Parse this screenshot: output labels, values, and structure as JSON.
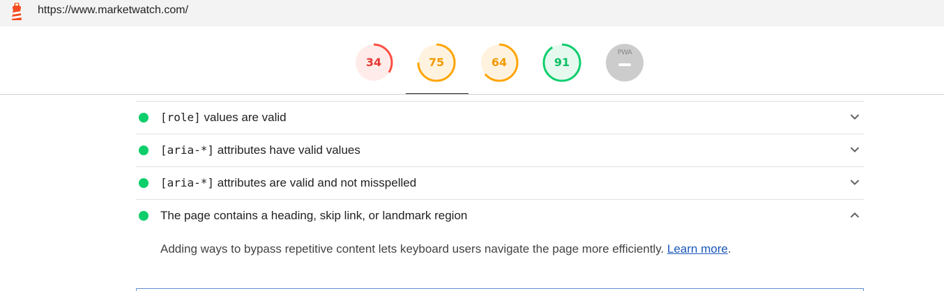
{
  "header": {
    "url": "https://www.marketwatch.com/",
    "logo_icon": "lighthouse-icon"
  },
  "scores": [
    {
      "label": "34",
      "value": 34,
      "color": "#ff4e42",
      "bg": "#ffecea"
    },
    {
      "label": "75",
      "value": 75,
      "color": "#ffa400",
      "bg": "#fff3e0"
    },
    {
      "label": "64",
      "value": 64,
      "color": "#ffa400",
      "bg": "#fff3e0"
    },
    {
      "label": "91",
      "value": 91,
      "color": "#0cce6b",
      "bg": "#e6f9ef"
    }
  ],
  "pwa": {
    "label": "PWA",
    "icon": "pwa-badge-icon",
    "color": "#cccccc"
  },
  "audits": [
    {
      "code": "[role]",
      "text": " values are valid",
      "expanded": false
    },
    {
      "code": "[aria-*]",
      "text": " attributes have valid values",
      "expanded": false
    },
    {
      "code": "[aria-*]",
      "text": " attributes are valid and not misspelled",
      "expanded": false
    },
    {
      "code": "",
      "text": "The page contains a heading, skip link, or landmark region",
      "expanded": true
    }
  ],
  "expanded": {
    "description": "Adding ways to bypass repetitive content lets keyboard users navigate the page more efficiently. ",
    "link_text": "Learn more",
    "suffix": "."
  },
  "colors": {
    "pass": "#0cce6b",
    "link": "#1a56b8"
  }
}
